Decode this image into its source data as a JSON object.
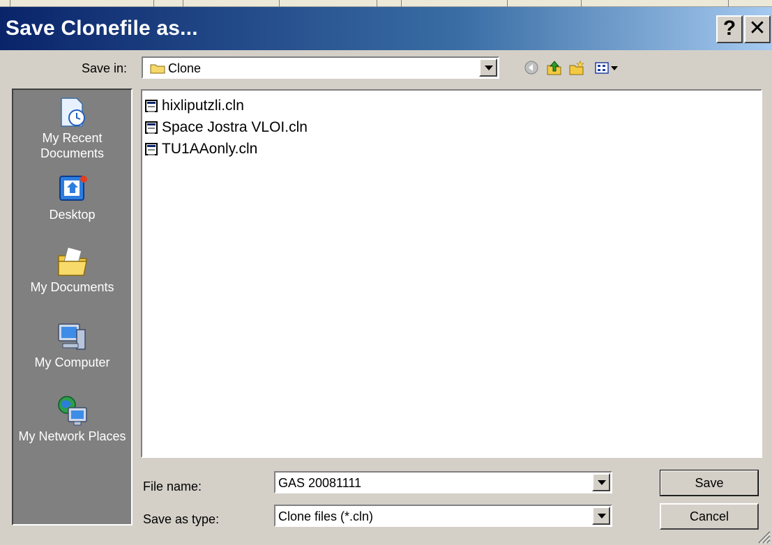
{
  "window": {
    "title": "Save Clonefile as...",
    "help_label": "?",
    "close_label": "✕"
  },
  "save_in": {
    "label": "Save in:",
    "value": "Clone"
  },
  "toolbar": {
    "icons": [
      "back-icon",
      "up-folder-icon",
      "new-folder-icon",
      "view-menu-icon"
    ]
  },
  "places": [
    {
      "label": "My Recent Documents",
      "icon": "recent-documents-icon"
    },
    {
      "label": "Desktop",
      "icon": "desktop-icon"
    },
    {
      "label": "My Documents",
      "icon": "my-documents-icon"
    },
    {
      "label": "My Computer",
      "icon": "my-computer-icon"
    },
    {
      "label": "My Network Places",
      "icon": "network-places-icon"
    }
  ],
  "files": [
    {
      "name": "hixliputzli.cln"
    },
    {
      "name": "Space Jostra VLOI.cln"
    },
    {
      "name": "TU1AAonly.cln"
    }
  ],
  "file_name": {
    "label": "File name:",
    "value": "GAS 20081111"
  },
  "save_as_type": {
    "label": "Save as type:",
    "value": "Clone files (*.cln)"
  },
  "buttons": {
    "save": "Save",
    "cancel": "Cancel"
  },
  "colors": {
    "title_gradient_start": "#0a246a",
    "title_gradient_end": "#a6caf0",
    "dialog_bg": "#d4d0c8",
    "places_bg": "#808080"
  }
}
